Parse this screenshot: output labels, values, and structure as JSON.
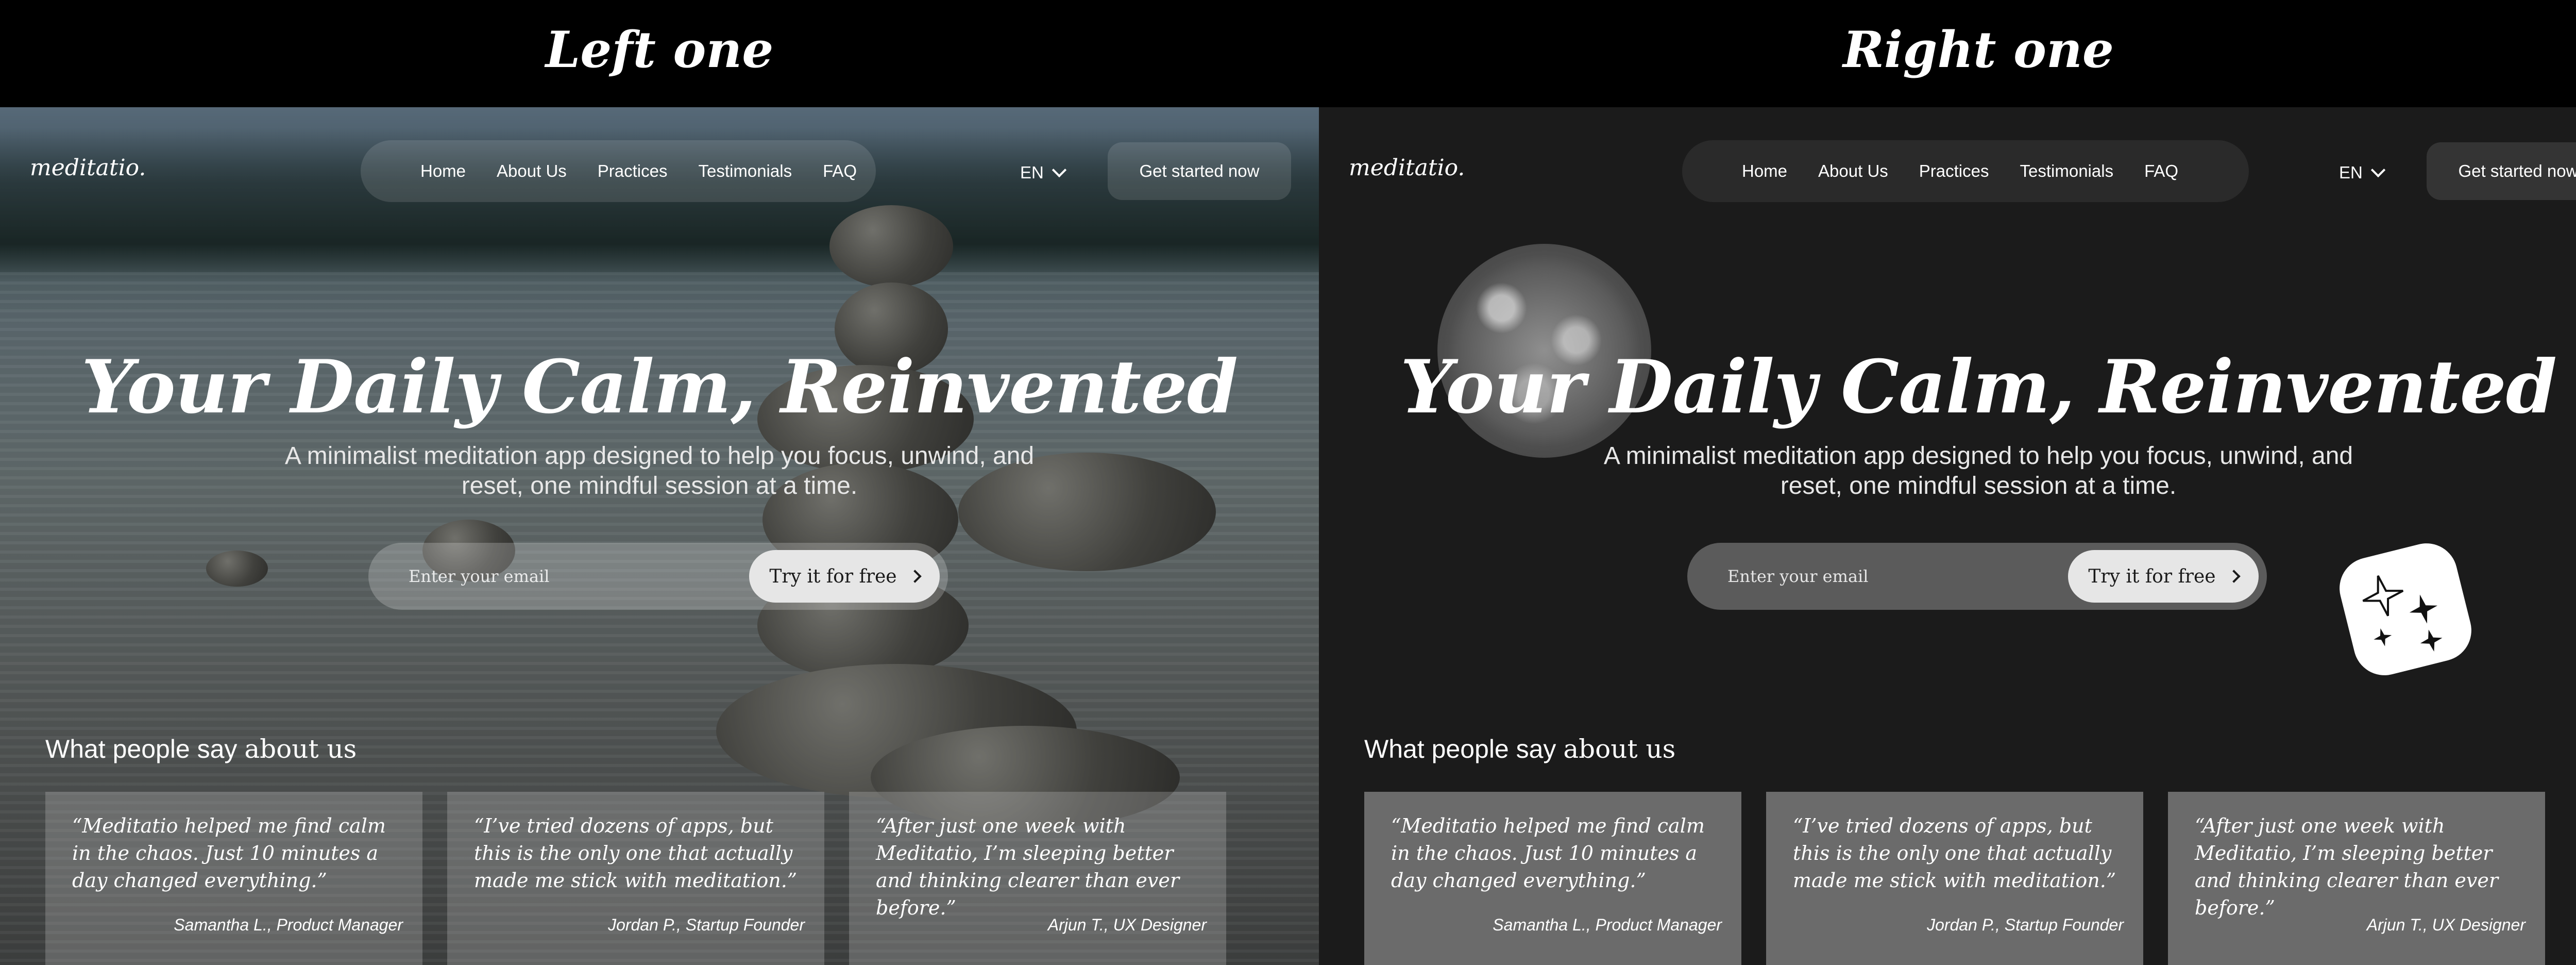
{
  "comparison": {
    "left_title": "Left one",
    "right_title": "Right one"
  },
  "left": {
    "logo": "meditatio.",
    "nav": [
      "Home",
      "About Us",
      "Practices",
      "Testimonials",
      "FAQ"
    ],
    "lang": "EN",
    "cta": "Get started now",
    "hero": {
      "title": "Your Daily Calm, Reinvented",
      "subtitle_line1": "A minimalist meditation app designed to help you focus, unwind, and",
      "subtitle_line2": "reset, one mindful session at a time."
    },
    "email": {
      "placeholder": "Enter your email",
      "button": "Try it for free"
    },
    "testimonials_title_prefix": "What people say",
    "testimonials_title_suffix": "about us",
    "testimonials": [
      {
        "quote": "“Meditatio helped me find calm in the chaos. Just 10 minutes a day changed everything.”",
        "author": "Samantha L., Product Manager"
      },
      {
        "quote": "“I’ve tried dozens of apps, but this is the only one that actually made me stick with meditation.”",
        "author": "Jordan P., Startup Founder"
      },
      {
        "quote": "“After just one week with Meditatio, I’m sleeping better and thinking clearer than ever before.”",
        "author": "Arjun T., UX Designer"
      }
    ]
  },
  "right": {
    "logo": "meditatio.",
    "nav": [
      "Home",
      "About Us",
      "Practices",
      "Testimonials",
      "FAQ"
    ],
    "lang": "EN",
    "cta": "Get started now",
    "hero": {
      "title": "Your Daily Calm, Reinvented",
      "subtitle_line1": "A minimalist meditation app designed to help you focus, unwind, and",
      "subtitle_line2": "reset, one mindful session at a time."
    },
    "email": {
      "placeholder": "Enter your email",
      "button": "Try it for free"
    },
    "testimonials_title_prefix": "What people say",
    "testimonials_title_suffix": "about us",
    "testimonials": [
      {
        "quote": "“Meditatio helped me find calm in the chaos. Just 10 minutes a day changed everything.”",
        "author": "Samantha L., Product Manager"
      },
      {
        "quote": "“I’ve tried dozens of apps, but this is the only one that actually made me stick with meditation.”",
        "author": "Jordan P., Startup Founder"
      },
      {
        "quote": "“After just one week with Meditatio, I’m sleeping better and thinking clearer than ever before.”",
        "author": "Arjun T., UX Designer"
      }
    ],
    "decor": {
      "moon": "moon-image",
      "sparkles": "sparkles-icon"
    }
  },
  "colors": {
    "dark_bg": "#1b1b1b",
    "nav_pill": "#2a2a2a",
    "card_gray": "#6b6b6b",
    "button_light": "#e6e6e6"
  }
}
